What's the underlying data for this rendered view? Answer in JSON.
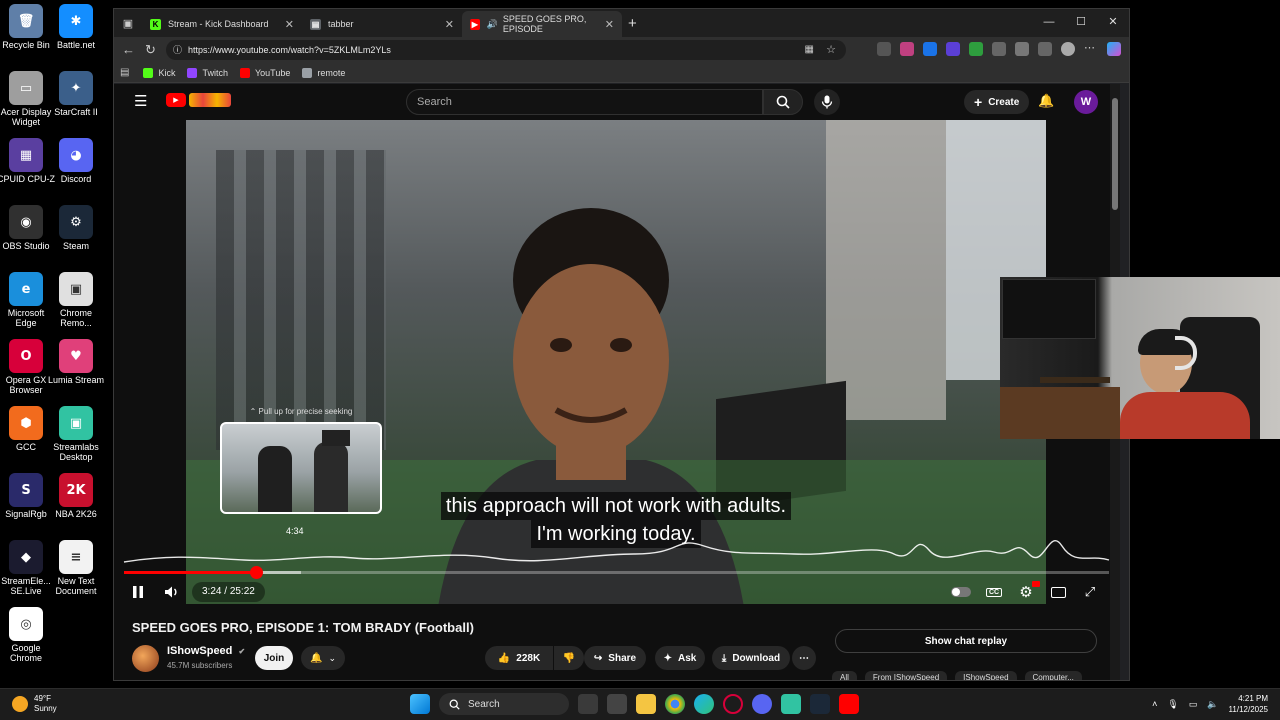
{
  "desktop": {
    "icons": [
      {
        "label": "Recycle Bin",
        "color": "#5f7fa8",
        "glyph": "🗑"
      },
      {
        "label": "Battle.net",
        "color": "#148eff",
        "glyph": "✱"
      },
      {
        "label": "Acer Display Widget",
        "color": "#9e9e9e",
        "glyph": "▭"
      },
      {
        "label": "StarCraft II",
        "color": "#3b5f8a",
        "glyph": "✦"
      },
      {
        "label": "CPUID CPU-Z",
        "color": "#5a3fa0",
        "glyph": "▦"
      },
      {
        "label": "Discord",
        "color": "#5865f2",
        "glyph": "◕"
      },
      {
        "label": "OBS Studio",
        "color": "#303030",
        "glyph": "◉"
      },
      {
        "label": "Steam",
        "color": "#1b2838",
        "glyph": "⚙"
      },
      {
        "label": "Microsoft Edge",
        "color": "#1a8fdc",
        "glyph": "e"
      },
      {
        "label": "Chrome Remo...",
        "color": "#e0e0e0",
        "glyph": "▣"
      },
      {
        "label": "Opera GX Browser",
        "color": "#d7003a",
        "glyph": "O"
      },
      {
        "label": "Lumia Stream",
        "color": "#e0407a",
        "glyph": "♥"
      },
      {
        "label": "GCC",
        "color": "#f26b1d",
        "glyph": "⬢"
      },
      {
        "label": "Streamlabs Desktop",
        "color": "#31c3a2",
        "glyph": "▣"
      },
      {
        "label": "SignalRgb",
        "color": "#2a2a6a",
        "glyph": "S"
      },
      {
        "label": "NBA 2K26",
        "color": "#c8102e",
        "glyph": "2K"
      },
      {
        "label": "StreamEle... SE.Live",
        "color": "#1b1b2f",
        "glyph": "◆"
      },
      {
        "label": "New Text Document",
        "color": "#f2f2f2",
        "glyph": "≡"
      },
      {
        "label": "Google Chrome",
        "color": "#ffffff",
        "glyph": "◎"
      }
    ]
  },
  "browser": {
    "tabs": [
      {
        "title": "Stream - Kick Dashboard",
        "fav_color": "#53fc18",
        "fav_glyph": "K"
      },
      {
        "title": "tabber",
        "fav_color": "#9aa0a6",
        "fav_glyph": "▤"
      },
      {
        "title": "SPEED GOES PRO, EPISODE",
        "fav_color": "#ff0000",
        "fav_glyph": "▶"
      }
    ],
    "new_tab": "+",
    "url": "https://www.youtube.com/watch?v=5ZKLMLm2YLs",
    "bookmarks": [
      {
        "label": "Kick",
        "color": "#53fc18"
      },
      {
        "label": "Twitch",
        "color": "#9146ff"
      },
      {
        "label": "YouTube",
        "color": "#ff0000"
      },
      {
        "label": "remote",
        "color": "#9aa0a6"
      }
    ]
  },
  "youtube": {
    "search_placeholder": "Search",
    "create_label": "Create",
    "avatar_letter": "W",
    "subtitle_line1": "this approach will not work with adults.",
    "subtitle_line2": "I'm working today.",
    "seek_hint": "⌃ Pull up for precise seeking",
    "preview_time": "4:34",
    "current_time": "3:24",
    "duration": "25:22",
    "progress": 0.134,
    "hover_progress": 0.18,
    "video_title": "SPEED GOES PRO, EPISODE 1: TOM BRADY (Football)",
    "channel_name": "IShowSpeed",
    "channel_subs": "45.7M subscribers",
    "join_label": "Join",
    "like_count": "228K",
    "share_label": "Share",
    "ask_label": "Ask",
    "download_label": "Download",
    "chat_replay_label": "Show chat replay",
    "chips": [
      "All",
      "From IShowSpeed",
      "IShowSpeed",
      "Computer..."
    ],
    "accent": "#ff0000"
  },
  "taskbar": {
    "temp": "49°F",
    "weather": "Sunny",
    "search_label": "Search",
    "time": "4:21 PM",
    "date": "11/12/2025"
  }
}
